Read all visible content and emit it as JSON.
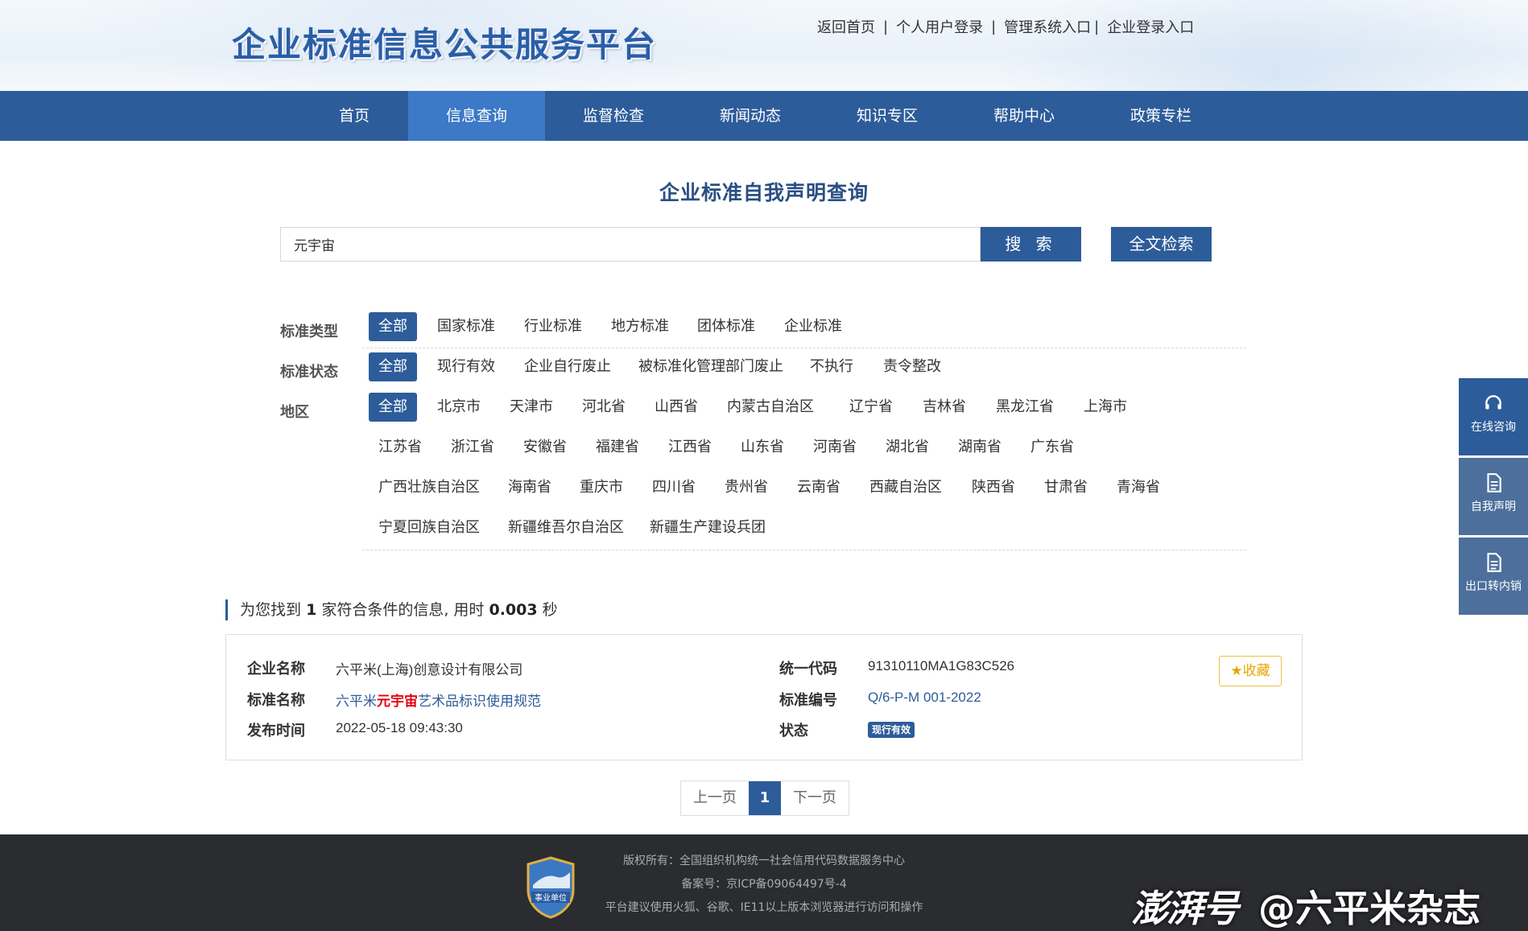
{
  "header": {
    "site_title": "企业标准信息公共服务平台",
    "links": [
      "返回首页",
      "个人用户登录",
      "管理系统入口",
      "企业登录入口"
    ]
  },
  "nav": {
    "items": [
      "首页",
      "信息查询",
      "监督检查",
      "新闻动态",
      "知识专区",
      "帮助中心",
      "政策专栏"
    ],
    "active": "信息查询"
  },
  "search": {
    "title": "企业标准自我声明查询",
    "value": "元宇宙",
    "search_label": "搜 索",
    "fulltext_label": "全文检索"
  },
  "filters": {
    "type": {
      "label": "标准类型",
      "options": [
        "全部",
        "国家标准",
        "行业标准",
        "地方标准",
        "团体标准",
        "企业标准"
      ],
      "selected": "全部"
    },
    "status": {
      "label": "标准状态",
      "options": [
        "全部",
        "现行有效",
        "企业自行废止",
        "被标准化管理部门废止",
        "不执行",
        "责令整改"
      ],
      "selected": "全部"
    },
    "region": {
      "label": "地区",
      "rows": [
        [
          "全部",
          "北京市",
          "天津市",
          "河北省",
          "山西省",
          "内蒙古自治区",
          "辽宁省",
          "吉林省",
          "黑龙江省",
          "上海市"
        ],
        [
          "江苏省",
          "浙江省",
          "安徽省",
          "福建省",
          "江西省",
          "山东省",
          "河南省",
          "湖北省",
          "湖南省",
          "广东省"
        ],
        [
          "广西壮族自治区",
          "海南省",
          "重庆市",
          "四川省",
          "贵州省",
          "云南省",
          "西藏自治区",
          "陕西省",
          "甘肃省",
          "青海省"
        ],
        [
          "宁夏回族自治区",
          "新疆维吾尔自治区",
          "新疆生产建设兵团"
        ]
      ],
      "selected": "全部"
    }
  },
  "summary": {
    "prefix": "为您找到",
    "count": "1",
    "middle": "家符合条件的信息, 用时",
    "time": "0.003",
    "suffix": "秒"
  },
  "result": {
    "company_label": "企业名称",
    "company": "六平米(上海)创意设计有限公司",
    "standard_name_label": "标准名称",
    "standard_name_pre": "六平米",
    "standard_name_hl": "元宇宙",
    "standard_name_post": "艺术品标识使用规范",
    "publish_label": "发布时间",
    "publish_time": "2022-05-18 09:43:30",
    "code_label": "统一代码",
    "code": "91310110MA1G83C526",
    "std_no_label": "标准编号",
    "std_no": "Q/6-P-M 001-2022",
    "status_label": "状态",
    "status": "现行有效",
    "fav_label": "收藏"
  },
  "pager": {
    "prev": "上一页",
    "current": "1",
    "next": "下一页"
  },
  "side_panel": [
    "在线咨询",
    "自我声明",
    "出口转内销"
  ],
  "footer": {
    "copyright": "版权所有：全国组织机构统一社会信用代码数据服务中心",
    "icp": "备案号：京ICP备09064497号-4",
    "browser_tip": "平台建议使用火狐、谷歌、IE11以上版本浏览器进行访问和操作",
    "emblem_text": "事业单位"
  },
  "watermark": {
    "brand": "澎湃号",
    "author": "@六平米杂志"
  },
  "colors": {
    "primary": "#2d5c9a",
    "nav_active": "#3c79c6",
    "highlight": "#e60012",
    "footer_bg": "#2b2c30",
    "fav": "#e6a500"
  }
}
